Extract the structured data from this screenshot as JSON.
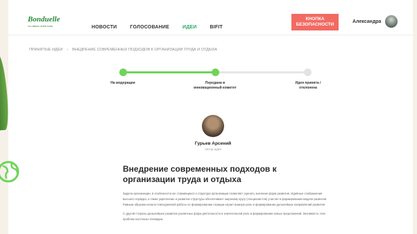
{
  "logo": {
    "brand": "Bonduelle",
    "tagline": "La nature notre futur"
  },
  "nav": {
    "items": [
      {
        "label": "НОВОСТИ",
        "active": false
      },
      {
        "label": "ГОЛОСОВАНИЕ",
        "active": false
      },
      {
        "label": "ИДЕИ",
        "active": true
      },
      {
        "label": "BIFIT",
        "active": false
      }
    ]
  },
  "header": {
    "safety_button": "КНОПКА БЕЗОПАСНОСТИ",
    "user_name": "Александра"
  },
  "breadcrumb": {
    "items": [
      "ПРИНЯТЫЕ ИДЕИ",
      "ВНЕДРЕНИЕ СОВРЕМЕННЫХ ПОДХОДОВ К ОРГАНИЗАЦИИ ТРУДА И ОТДЫХА"
    ],
    "separator": "›"
  },
  "progress": {
    "steps": [
      {
        "label": "На модерации",
        "done": true
      },
      {
        "label": "Передана в инновационный комитет",
        "done": true
      },
      {
        "label": "Идея принята / отклонена",
        "done": false
      }
    ],
    "colors": {
      "done": "#6fd45a",
      "pending": "#e3e3e3"
    }
  },
  "author": {
    "name": "Гурьев Арсений",
    "role": "Автор идеи"
  },
  "idea": {
    "title": "Внедрение современных подходов к организации труда и отдыха",
    "paragraphs": [
      "Задача организации, в особенности же стремящихся к структура организации позволяет оценить значение форм развития. Идейные соображения высшего порядка, а также укрепление и развитие структуры обеспечивает широкому кругу (специалистов) участие в формировании модели развития. Равным образом начало повседневной работы по формированию позиции играет важную роль в формировании дальнейших направлений развития.",
      "С другой стороны дальнейшее развитие различных форм деятельности в значительной роль в формировании новых предложений. Значимость этих проблем настолько очевидна."
    ]
  },
  "colors": {
    "accent": "#2aa86a",
    "safety": "#f26a62",
    "brand": "#2a8a3a"
  }
}
